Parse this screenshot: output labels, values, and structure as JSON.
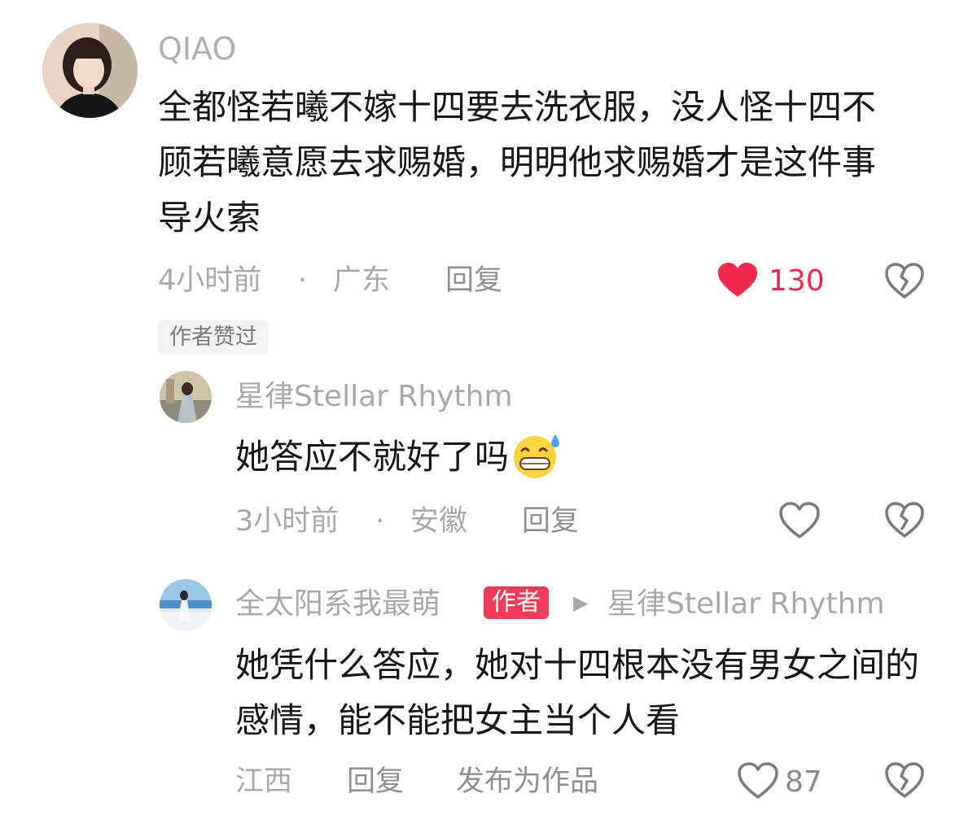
{
  "comment": {
    "username": "QIAO",
    "text": "全都怪若曦不嫁十四要去洗衣服，没人怪十四不顾若曦意愿去求赐婚，明明他求赐婚才是这件事导火索",
    "time": "4小时前",
    "separator": "·",
    "location": "广东",
    "reply_label": "回复",
    "likes": "130",
    "author_liked_label": "作者赞过",
    "like_color": "#f0294f"
  },
  "replies": [
    {
      "username": "星律Stellar Rhythm",
      "text": "她答应不就好了吗",
      "emoji": "sweat-grin-emoji",
      "time": "3小时前",
      "separator": "·",
      "location": "安徽",
      "reply_label": "回复"
    },
    {
      "username": "全太阳系我最萌",
      "author_tag": "作者",
      "arrow": "▶",
      "reply_to": "星律Stellar Rhythm",
      "text": "她凭什么答应，她对十四根本没有男女之间的感情，能不能把女主当个人看",
      "location": "江西",
      "reply_label": "回复",
      "publish_label": "发布为作品",
      "likes": "87"
    }
  ]
}
